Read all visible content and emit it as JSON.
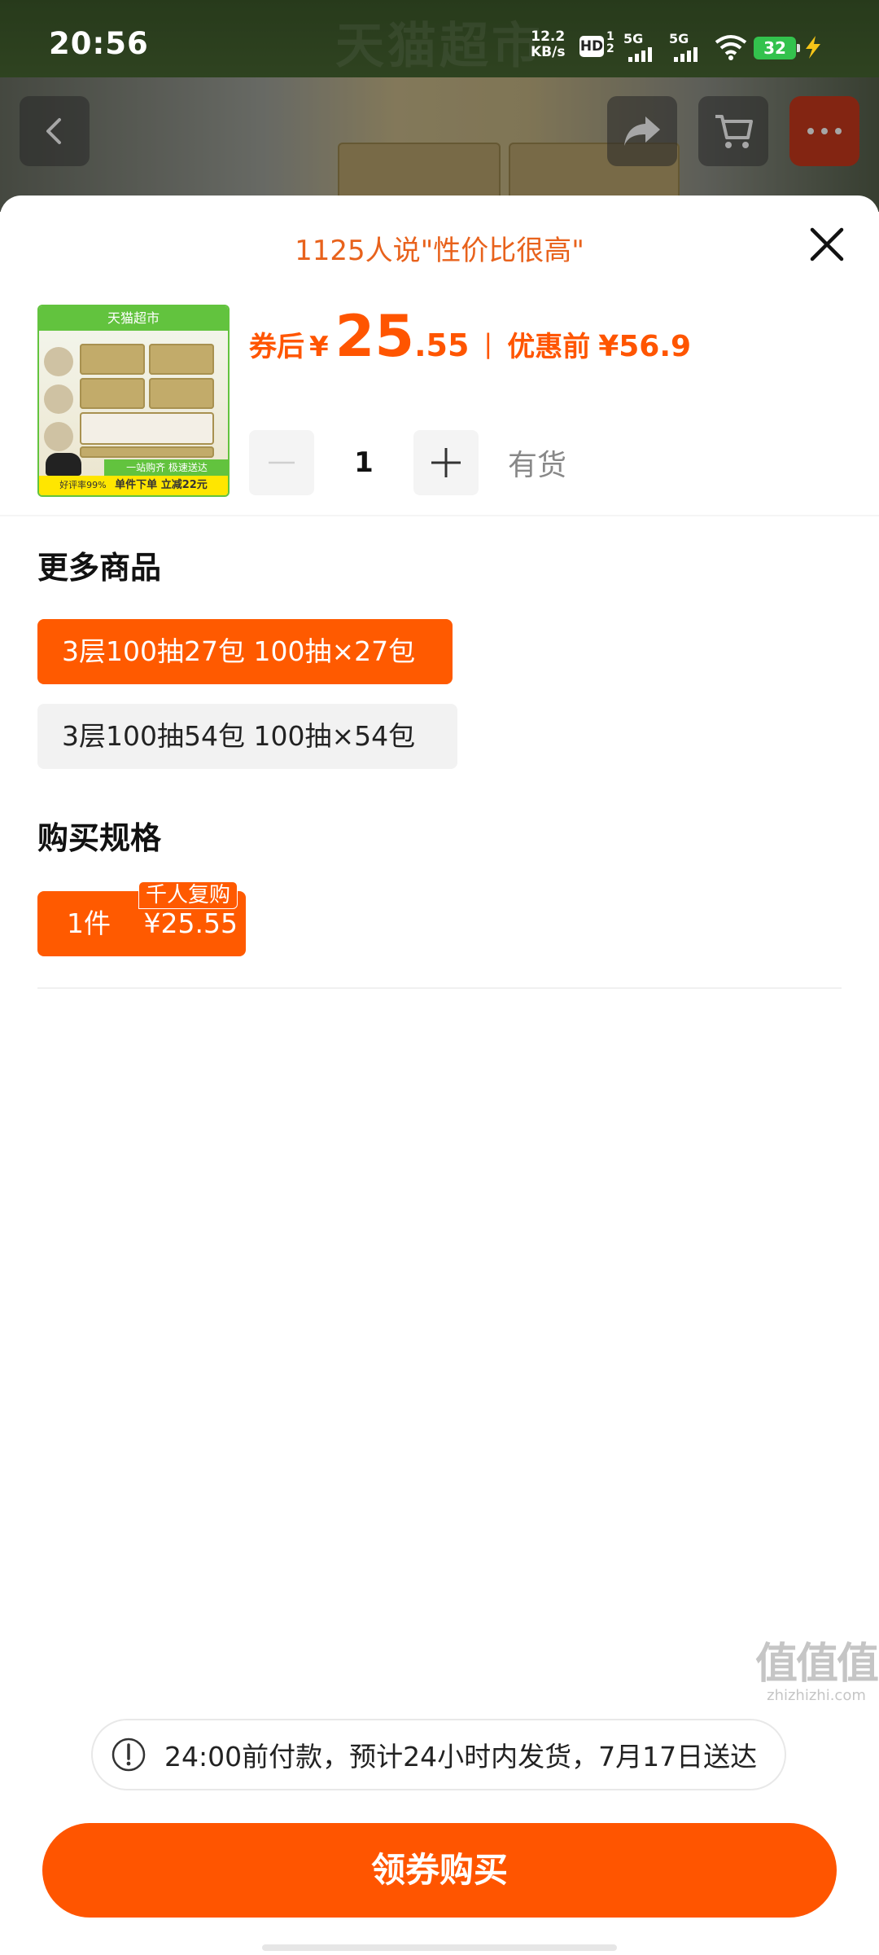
{
  "status_bar": {
    "time": "20:56",
    "net_speed_value": "12.2",
    "net_speed_unit": "KB/s",
    "hd_label": "HD",
    "hd_sub_top": "1",
    "hd_sub_bottom": "2",
    "sim1_label": "5G",
    "sim2_label": "5G",
    "battery": "32"
  },
  "background_page": {
    "title": "天猫超市"
  },
  "sheet": {
    "headline": "1125人说\"性价比很高\"",
    "thumbnail": {
      "top_text": "天猫超市",
      "strip_text": "一站购齐 极速送达",
      "bottom_left": "好评率99%",
      "bottom_text": "单件下单 立减22元"
    },
    "price": {
      "after_label": "券后",
      "currency": "¥",
      "integer": "25",
      "decimal": ".55",
      "separator": "|",
      "before_label": "优惠前",
      "original": "¥56.9"
    },
    "quantity": {
      "value": "1",
      "stock": "有货"
    },
    "more_products": {
      "title": "更多商品",
      "options": [
        {
          "label": "3层100抽27包 100抽×27包",
          "selected": true
        },
        {
          "label": "3层100抽54包 100抽×54包",
          "selected": false
        }
      ]
    },
    "spec": {
      "title": "购买规格",
      "chip_qty": "1件",
      "chip_price": "¥25.55",
      "badge": "千人复购"
    },
    "notice": "24:00前付款，预计24小时内发货，7月17日送达",
    "buy_button": "领券购买"
  },
  "watermark": {
    "big": "值值值",
    "small": "zhizhizhi.com"
  },
  "colors": {
    "accent": "#ff5500",
    "headline": "#e8621c",
    "stock_text": "#888888"
  }
}
